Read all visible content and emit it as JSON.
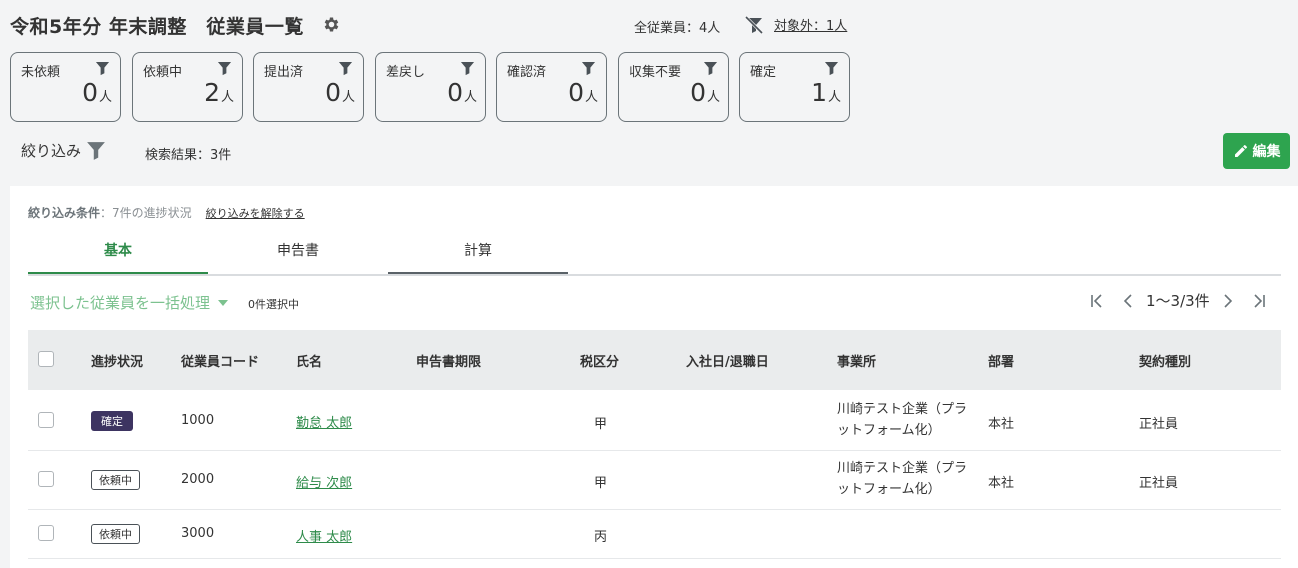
{
  "header": {
    "title": "令和5年分 年末調整　従業員一覧",
    "total_label": "全従業員：4人",
    "excluded_link": "対象外：1人"
  },
  "status_cards": [
    {
      "label": "未依頼",
      "count": "0",
      "unit": "人"
    },
    {
      "label": "依頼中",
      "count": "2",
      "unit": "人"
    },
    {
      "label": "提出済",
      "count": "0",
      "unit": "人"
    },
    {
      "label": "差戻し",
      "count": "0",
      "unit": "人"
    },
    {
      "label": "確認済",
      "count": "0",
      "unit": "人"
    },
    {
      "label": "収集不要",
      "count": "0",
      "unit": "人"
    },
    {
      "label": "確定",
      "count": "1",
      "unit": "人"
    }
  ],
  "toolbar": {
    "filter_label": "絞り込み",
    "result_label": "検索結果：3件",
    "edit_label": "編集"
  },
  "filter_condition": {
    "label": "絞り込み条件",
    "value": "：7件の進捗状況",
    "clear_label": "絞り込みを解除する"
  },
  "tabs": [
    {
      "label": "基本"
    },
    {
      "label": "申告書"
    },
    {
      "label": "計算"
    }
  ],
  "bulk": {
    "label": "選択した従業員を一括処理",
    "selected": "0件選択中"
  },
  "pagination": {
    "range": "1〜3/3件"
  },
  "table": {
    "columns": [
      "進捗状況",
      "従業員コード",
      "氏名",
      "申告書期限",
      "税区分",
      "入社日/退職日",
      "事業所",
      "部署",
      "契約種別"
    ],
    "rows": [
      {
        "status": "確定",
        "code": "1000",
        "name": "勤怠 太郎",
        "deadline": "",
        "tax": "甲",
        "dates": "",
        "office": "川崎テスト企業（プラットフォーム化）",
        "dept": "本社",
        "contract": "正社員"
      },
      {
        "status": "依頼中",
        "code": "2000",
        "name": "給与 次郎",
        "deadline": "",
        "tax": "甲",
        "dates": "",
        "office": "川崎テスト企業（プラットフォーム化）",
        "dept": "本社",
        "contract": "正社員"
      },
      {
        "status": "依頼中",
        "code": "3000",
        "name": "人事 太郎",
        "deadline": "",
        "tax": "丙",
        "dates": "",
        "office": "",
        "dept": "",
        "contract": ""
      }
    ]
  },
  "colors": {
    "accent_green": "#2e8b4a",
    "edit_button": "#2ea44f",
    "confirmed_badge": "#3d3461",
    "bulk_text": "#7cc28f"
  },
  "icons": {
    "settings": "gear-icon",
    "filter": "filter-icon",
    "excluded": "filter-off-icon",
    "edit": "pencil-icon"
  }
}
